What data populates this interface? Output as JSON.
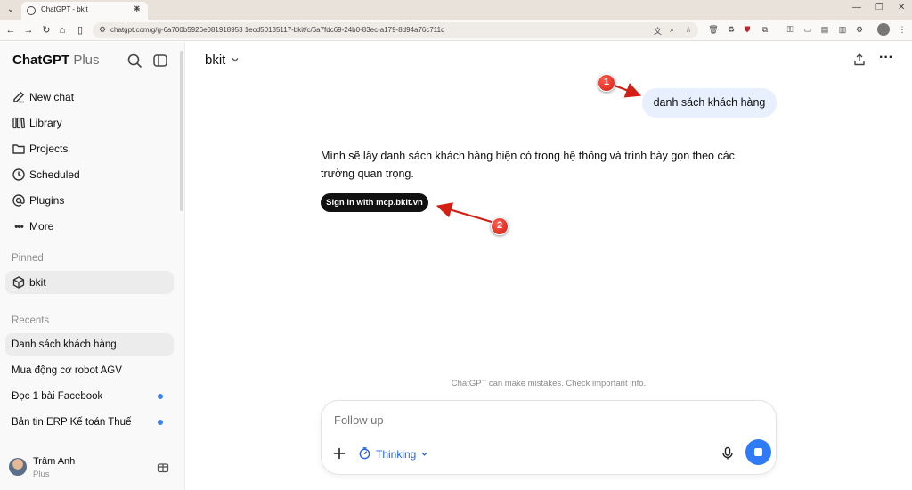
{
  "browser": {
    "tab_title": "ChatGPT - bkit",
    "url": "chatgpt.com/g/g-6a700b5926e081918953 1ecd50135117-bkit/c/6a7fdc69-24b0-83ec-a179-8d94a76c711d"
  },
  "sidebar": {
    "brand_name": "ChatGPT",
    "brand_plan": "Plus",
    "nav": [
      {
        "label": "New chat",
        "icon": "edit-icon"
      },
      {
        "label": "Library",
        "icon": "library-icon"
      },
      {
        "label": "Projects",
        "icon": "folder-icon"
      },
      {
        "label": "Scheduled",
        "icon": "clock-icon"
      },
      {
        "label": "Plugins",
        "icon": "at-icon"
      },
      {
        "label": "More",
        "icon": "more-dots-icon"
      }
    ],
    "pinned_header": "Pinned",
    "pinned": [
      {
        "label": "bkit"
      }
    ],
    "recents_header": "Recents",
    "recents": [
      {
        "label": "Danh sách khách hàng",
        "unread": false
      },
      {
        "label": "Mua động cơ robot AGV",
        "unread": false
      },
      {
        "label": "Đọc 1 bài Facebook",
        "unread": true
      },
      {
        "label": "Bản tin ERP Kế toán Thuế",
        "unread": true
      }
    ],
    "user": {
      "name": "Trâm Anh",
      "plan": "Plus"
    }
  },
  "main": {
    "model_name": "bkit",
    "user_message": "danh sách khách hàng",
    "assistant_message": "Mình sẽ lấy danh sách khách hàng hiện có trong hệ thống và trình bày gọn theo các trường quan trọng.",
    "signin_button": "Sign in with mcp.bkit.vn",
    "disclaimer": "ChatGPT can make mistakes. Check important info.",
    "composer_placeholder": "Follow up",
    "thinking_label": "Thinking"
  },
  "annotations": {
    "badge_1": "1",
    "badge_2": "2"
  },
  "colors": {
    "accent": "#2f7bf5",
    "bubble": "#e8f0fe",
    "annotation_red": "#d21f14"
  }
}
